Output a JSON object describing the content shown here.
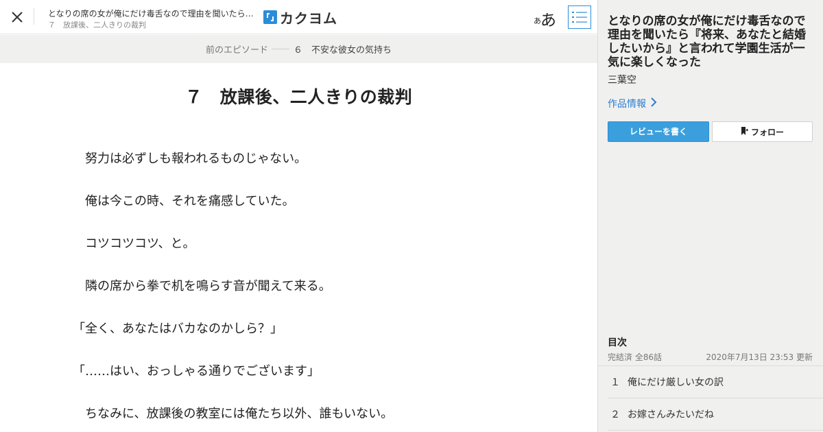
{
  "header": {
    "work_title": "となりの席の女が俺にだけ毒舌なので理由を聞いたら…",
    "episode_subtitle": "７　放課後、二人きりの裁判",
    "logo_text": "カクヨム",
    "font_small": "あ",
    "font_big": "あ"
  },
  "prev_episode": {
    "label": "前のエピソード",
    "title": "６　不安な彼女の気持ち"
  },
  "chapter": {
    "title": "７　放課後、二人きりの裁判",
    "paragraphs": [
      "　努力は必ずしも報われるものじゃない。",
      "　俺は今この時、それを痛感していた。",
      "　コツコツコツ、と。",
      "　隣の席から拳で机を鳴らす音が聞えて来る。",
      "「全く、あなたはバカなのかしら？」",
      "「……はい、おっしゃる通りでございます」",
      "　ちなみに、放課後の教室には俺たち以外、誰もいない。"
    ]
  },
  "sidebar": {
    "title": "となりの席の女が俺にだけ毒舌なので理由を聞いたら『将来、あなたと結婚したいから』と言われて学園生活が一気に楽しくなった",
    "author": "三葉空",
    "work_info_label": "作品情報",
    "review_button": "レビューを書く",
    "follow_button": "フォロー",
    "toc": {
      "heading": "目次",
      "status": "完結済 全86話",
      "updated": "2020年7月13日 23:53 更新",
      "items": [
        {
          "num": "１",
          "title": "俺にだけ厳しい女の訳"
        },
        {
          "num": "２",
          "title": "お嫁さんみたいだね"
        }
      ]
    }
  },
  "colors": {
    "accent": "#2b8dd8",
    "link": "#2b7ecf",
    "sidebar_bg": "#f0f0ef"
  },
  "icons": {
    "close": "close-icon",
    "logo": "kakuyomu-logo-icon",
    "toc": "list-icon",
    "chevron": "chevron-right-icon",
    "bookmark": "bookmark-plus-icon"
  }
}
